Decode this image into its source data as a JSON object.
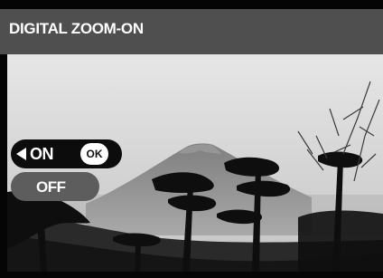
{
  "screen": {
    "title": "DIGITAL ZOOM-ON"
  },
  "menu": {
    "options": [
      {
        "label": "ON",
        "selected": true,
        "arrow_icon": "left-arrow-icon"
      },
      {
        "label": "OFF",
        "selected": false
      }
    ],
    "confirm_badge": "OK"
  },
  "colors": {
    "title_bar": "#4f4f4f",
    "selected_option": "#0c0c0c",
    "unselected_option": "#5d5d5d",
    "text": "#ffffff"
  }
}
